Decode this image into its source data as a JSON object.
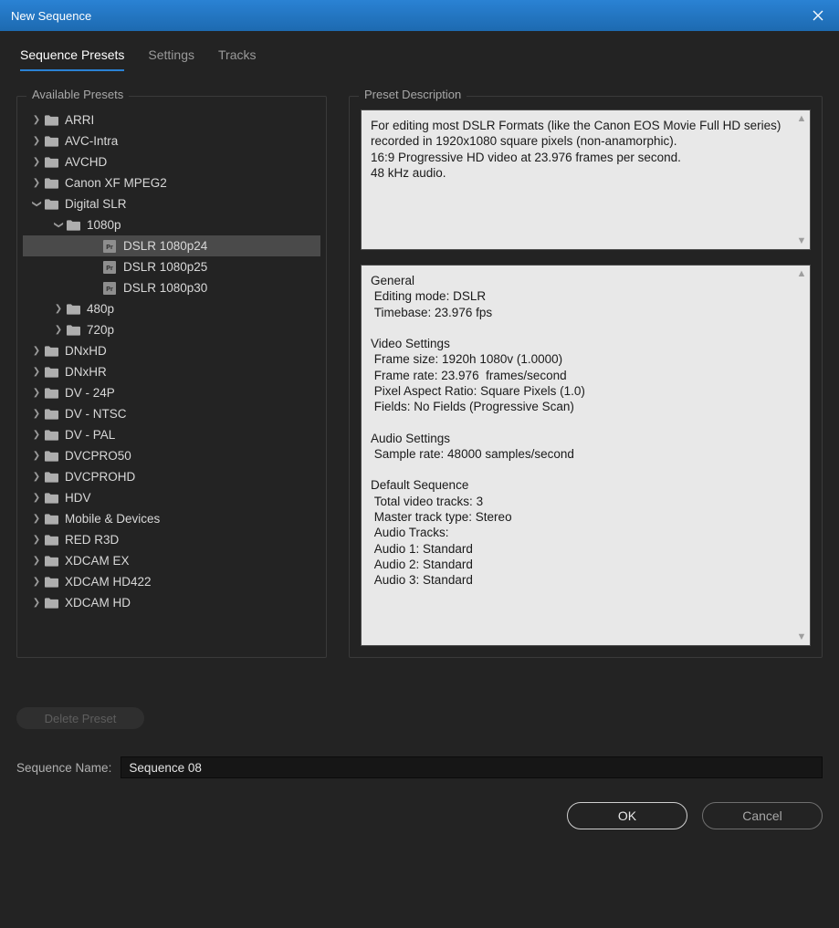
{
  "window": {
    "title": "New Sequence"
  },
  "tabs": {
    "presets": "Sequence Presets",
    "settings": "Settings",
    "tracks": "Tracks"
  },
  "panels": {
    "available": "Available Presets",
    "description": "Preset Description"
  },
  "tree": {
    "arri": "ARRI",
    "avcintra": "AVC-Intra",
    "avchd": "AVCHD",
    "canonxf": "Canon XF MPEG2",
    "digitalslr": "Digital SLR",
    "p1080": "1080p",
    "dslr24": "DSLR 1080p24",
    "dslr25": "DSLR 1080p25",
    "dslr30": "DSLR 1080p30",
    "p480": "480p",
    "p720": "720p",
    "dnxhd": "DNxHD",
    "dnxhr": "DNxHR",
    "dv24p": "DV - 24P",
    "dvntsc": "DV - NTSC",
    "dvpal": "DV - PAL",
    "dvcpro50": "DVCPRO50",
    "dvcprohd": "DVCPROHD",
    "hdv": "HDV",
    "mobile": "Mobile & Devices",
    "red": "RED R3D",
    "xdcamex": "XDCAM EX",
    "xdcamhd422": "XDCAM HD422",
    "xdcamhd": "XDCAM HD"
  },
  "description_text": "For editing most DSLR Formats (like the Canon EOS Movie Full HD series) recorded in 1920x1080 square pixels (non-anamorphic).\n16:9 Progressive HD video at 23.976 frames per second.\n48 kHz audio.",
  "details_text": "General\n Editing mode: DSLR\n Timebase: 23.976 fps\n\nVideo Settings\n Frame size: 1920h 1080v (1.0000)\n Frame rate: 23.976  frames/second\n Pixel Aspect Ratio: Square Pixels (1.0)\n Fields: No Fields (Progressive Scan)\n\nAudio Settings\n Sample rate: 48000 samples/second\n\nDefault Sequence\n Total video tracks: 3\n Master track type: Stereo\n Audio Tracks:\n Audio 1: Standard\n Audio 2: Standard\n Audio 3: Standard",
  "delete_preset": "Delete Preset",
  "seqname": {
    "label": "Sequence Name:",
    "value": "Sequence 08"
  },
  "buttons": {
    "ok": "OK",
    "cancel": "Cancel"
  }
}
